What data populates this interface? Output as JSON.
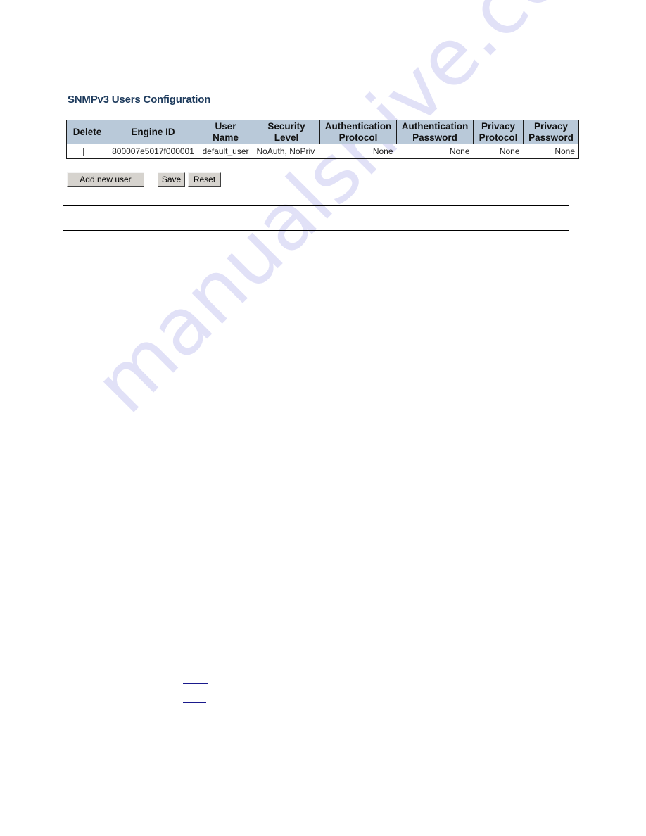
{
  "page": {
    "title": "SNMPv3 Users Configuration"
  },
  "table": {
    "headers": {
      "delete": "Delete",
      "engine_id": "Engine ID",
      "user_name": [
        "User",
        "Name"
      ],
      "security_level": [
        "Security",
        "Level"
      ],
      "auth_protocol": [
        "Authentication",
        "Protocol"
      ],
      "auth_password": [
        "Authentication",
        "Password"
      ],
      "privacy_protocol": [
        "Privacy",
        "Protocol"
      ],
      "privacy_password": [
        "Privacy",
        "Password"
      ]
    },
    "rows": [
      {
        "delete_checked": false,
        "engine_id": "800007e5017f000001",
        "user_name": "default_user",
        "security_level": "NoAuth, NoPriv",
        "auth_protocol": "None",
        "auth_password": "None",
        "privacy_protocol": "None",
        "privacy_password": "None"
      }
    ]
  },
  "buttons": {
    "add_new_user": "Add new user",
    "save": "Save",
    "reset": "Reset"
  },
  "watermark": "manualshive.com",
  "colors": {
    "title": "#1d3a5c",
    "header_bg": "#b9c9d9",
    "button_bg": "#d6d3ce",
    "link": "#1a1a8c",
    "watermark": "#dcdcf6"
  }
}
